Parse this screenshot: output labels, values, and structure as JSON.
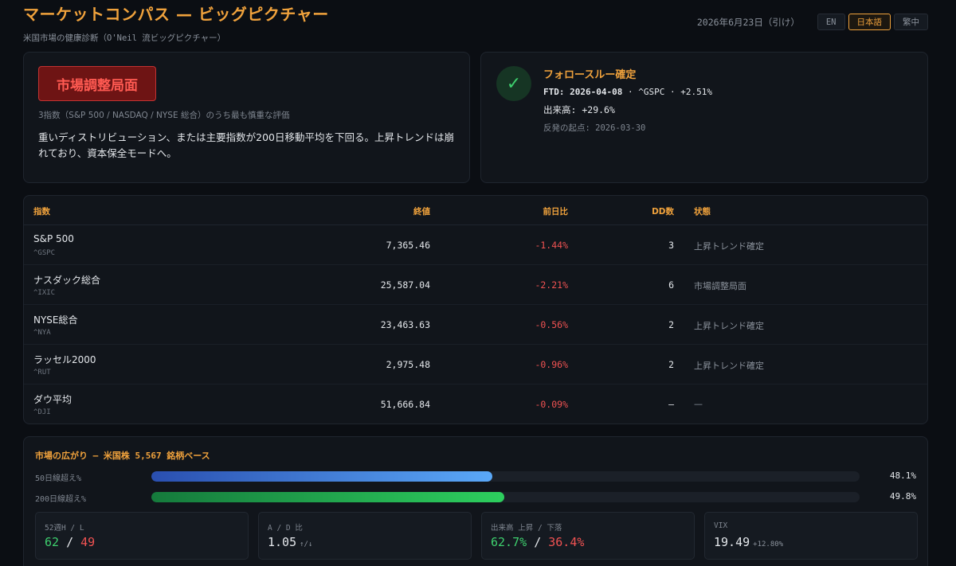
{
  "header": {
    "title": "マーケットコンパス — ビッグピクチャー",
    "subtitle": "米国市場の健康診断（O'Neil 流ビッグピクチャー）",
    "date": "2026年6月23日（引け）",
    "languages": [
      {
        "label": "EN",
        "active": false
      },
      {
        "label": "日本語",
        "active": true
      },
      {
        "label": "繁中",
        "active": false
      }
    ]
  },
  "regime": {
    "badge": "市場調整局面",
    "caption": "3指数（S&P 500 / NASDAQ / NYSE 総合）のうち最も慎重な評価",
    "description": "重いディストリビューション、または主要指数が200日移動平均を下回る。上昇トレンドは崩れており、資本保全モードへ。",
    "color": "#c23232"
  },
  "ftd": {
    "icon": "check-icon",
    "title": "フォロースルー確定",
    "label": "FTD:",
    "date": "2026-04-08",
    "detail": "· ^GSPC · +2.51%",
    "volume": "出来高: +29.6%",
    "rally_start": "反発の起点: 2026-03-30"
  },
  "table": {
    "headers": {
      "index": "指数",
      "close": "終値",
      "change": "前日比",
      "dd": "DD数",
      "status": "状態"
    },
    "rows": [
      {
        "name": "S&P 500",
        "ticker": "^GSPC",
        "close": "7,365.46",
        "change": "-1.44%",
        "dd": "3",
        "status": "上昇トレンド確定"
      },
      {
        "name": "ナスダック総合",
        "ticker": "^IXIC",
        "close": "25,587.04",
        "change": "-2.21%",
        "dd": "6",
        "status": "市場調整局面"
      },
      {
        "name": "NYSE総合",
        "ticker": "^NYA",
        "close": "23,463.63",
        "change": "-0.56%",
        "dd": "2",
        "status": "上昇トレンド確定"
      },
      {
        "name": "ラッセル2000",
        "ticker": "^RUT",
        "close": "2,975.48",
        "change": "-0.96%",
        "dd": "2",
        "status": "上昇トレンド確定"
      },
      {
        "name": "ダウ平均",
        "ticker": "^DJI",
        "close": "51,666.84",
        "change": "-0.09%",
        "dd": "—",
        "status": "—"
      }
    ]
  },
  "breadth": {
    "title": "市場の広がり — 米国株 5,567 銘柄ベース",
    "bars": [
      {
        "label": "50日線超え%",
        "value": "48.1%",
        "fraction": 0.481,
        "gradient": [
          "#2a4fb0",
          "#5aa8f8"
        ]
      },
      {
        "label": "200日線超え%",
        "value": "49.8%",
        "fraction": 0.498,
        "gradient": [
          "#157a3c",
          "#2dcf5e"
        ]
      }
    ],
    "stats": {
      "highs_lows": {
        "label": "52週H / L",
        "highs": "62",
        "sep": "/",
        "lows": "49"
      },
      "ad": {
        "label": "A / D 比",
        "value": "1.05",
        "suffix": "↑/↓"
      },
      "volume": {
        "label": "出来高 上昇 / 下落",
        "up": "62.7%",
        "sep": "/",
        "down": "36.4%"
      },
      "vix": {
        "label": "VIX",
        "value": "19.49",
        "change": "+12.80%"
      }
    }
  }
}
